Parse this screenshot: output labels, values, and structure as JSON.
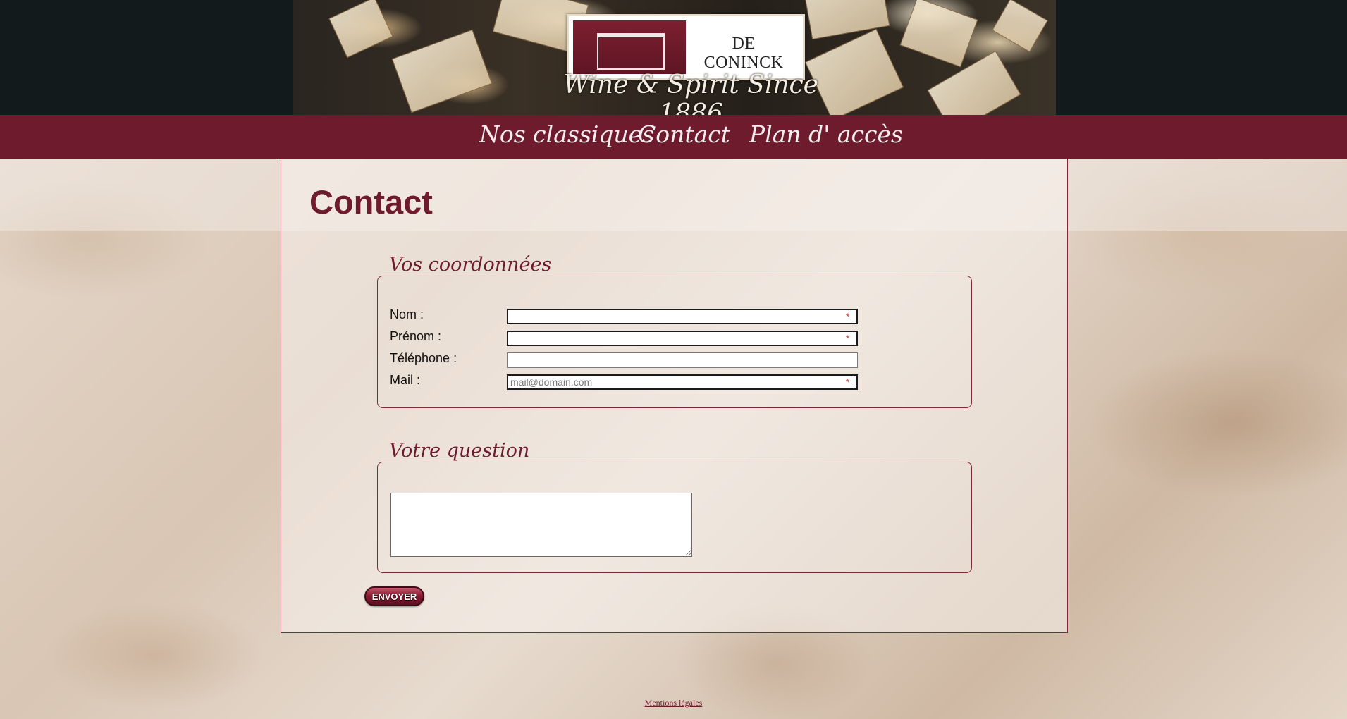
{
  "header": {
    "logo_text": "DE CONINCK",
    "tagline": "Wine & Spirit Since 1886"
  },
  "nav": {
    "items": [
      {
        "label": "Nos classiques"
      },
      {
        "label": "Contact"
      },
      {
        "label": "Plan d' accès"
      }
    ]
  },
  "page": {
    "title": "Contact"
  },
  "coordinates": {
    "legend": "Vos coordonnées",
    "fields": [
      {
        "label": "Nom :",
        "value": "",
        "required": true,
        "required_mark": "*"
      },
      {
        "label": "Prénom :",
        "value": "",
        "required": true,
        "required_mark": "*"
      },
      {
        "label": "Téléphone :",
        "value": "",
        "required": false
      },
      {
        "label": "Mail :",
        "value": "",
        "placeholder": "mail@domain.com",
        "required": true,
        "required_mark": "*"
      }
    ]
  },
  "question": {
    "legend": "Votre question",
    "value": ""
  },
  "send_button": {
    "label": "ENVOYER"
  },
  "footer": {
    "legal_link": "Mentions légales"
  },
  "colors": {
    "brand": "#6e1b2d",
    "header_background": "#121a1b",
    "required_mark": "#d23b3b"
  }
}
